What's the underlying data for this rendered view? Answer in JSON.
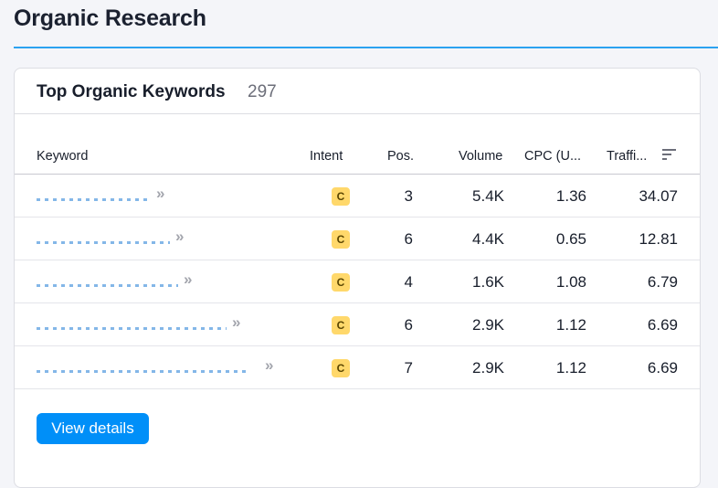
{
  "page": {
    "title": "Organic Research"
  },
  "card": {
    "title": "Top Organic Keywords",
    "count": "297",
    "columns": {
      "keyword": "Keyword",
      "intent": "Intent",
      "pos": "Pos.",
      "volume": "Volume",
      "cpc": "CPC (U...",
      "traffic": "Traffi..."
    },
    "rows": [
      {
        "intent": "C",
        "pos": "3",
        "volume": "5.4K",
        "cpc": "1.36",
        "traffic": "34.07"
      },
      {
        "intent": "C",
        "pos": "6",
        "volume": "4.4K",
        "cpc": "0.65",
        "traffic": "12.81"
      },
      {
        "intent": "C",
        "pos": "4",
        "volume": "1.6K",
        "cpc": "1.08",
        "traffic": "6.79"
      },
      {
        "intent": "C",
        "pos": "6",
        "volume": "2.9K",
        "cpc": "1.12",
        "traffic": "6.69"
      },
      {
        "intent": "C",
        "pos": "7",
        "volume": "2.9K",
        "cpc": "1.12",
        "traffic": "6.69"
      }
    ],
    "view_details_label": "View details"
  },
  "colors": {
    "accent": "#008ff8",
    "header_line": "#2ca2f0",
    "intent_commercial": "#ffd86b",
    "keyword_link": "#5b9fe0"
  },
  "icons": {
    "sort": "sort-descending-icon",
    "chevron": "double-chevron-right-icon"
  }
}
